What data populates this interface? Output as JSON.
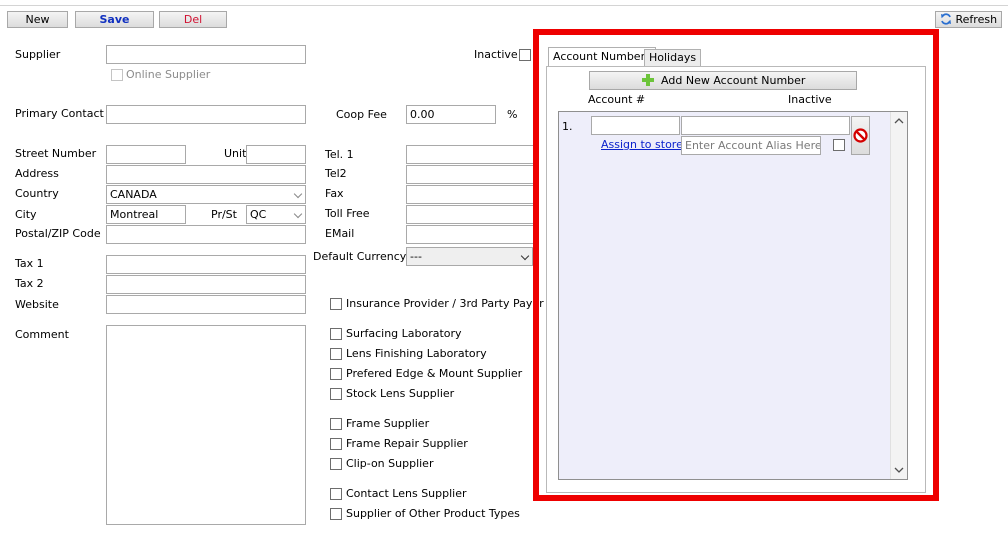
{
  "toolbar": {
    "new_label": "New",
    "save_label": "Save",
    "delete_label": "Del",
    "refresh_label": "Refresh"
  },
  "form": {
    "supplier_label": "Supplier",
    "supplier_value": "",
    "online_supplier_label": "Online Supplier",
    "inactive_label": "Inactive",
    "primary_contact_label": "Primary Contact",
    "primary_contact_value": "",
    "coop_fee_label": "Coop Fee",
    "coop_fee_value": "0.00",
    "coop_fee_unit": "%",
    "street_number_label": "Street Number",
    "street_number_value": "",
    "unit_label": "Unit",
    "unit_value": "",
    "address_label": "Address",
    "address_value": "",
    "country_label": "Country",
    "country_value": "CANADA",
    "city_label": "City",
    "city_value": "Montreal",
    "prst_label": "Pr/St",
    "prst_value": "QC",
    "postal_label": "Postal/ZIP Code",
    "postal_value": "",
    "tel1_label": "Tel. 1",
    "tel2_label": "Tel2",
    "fax_label": "Fax",
    "tollfree_label": "Toll Free",
    "email_label": "EMail",
    "default_currency_label": "Default Currency",
    "default_currency_value": "---",
    "tax1_label": "Tax 1",
    "tax2_label": "Tax 2",
    "website_label": "Website",
    "comment_label": "Comment"
  },
  "checkboxes": [
    {
      "label": "Insurance Provider / 3rd Party Payer",
      "checked": false
    },
    {
      "label": "Surfacing Laboratory",
      "checked": false
    },
    {
      "label": "Lens Finishing Laboratory",
      "checked": false
    },
    {
      "label": "Prefered Edge & Mount Supplier",
      "checked": false
    },
    {
      "label": "Stock Lens Supplier",
      "checked": false
    },
    {
      "label": "Frame Supplier",
      "checked": false
    },
    {
      "label": "Frame Repair Supplier",
      "checked": false
    },
    {
      "label": "Clip-on Supplier",
      "checked": false
    },
    {
      "label": "Contact Lens Supplier",
      "checked": false
    },
    {
      "label": "Supplier of Other Product Types",
      "checked": false
    }
  ],
  "account_panel": {
    "tabs": [
      {
        "label": "Account Numbers",
        "active": true
      },
      {
        "label": "Holidays",
        "active": false
      }
    ],
    "add_button_label": "Add New Account Number",
    "col_account_label": "Account #",
    "col_inactive_label": "Inactive",
    "rows": [
      {
        "index": "1.",
        "account_value": "",
        "second_value": "",
        "assign_link": "Assign to stores",
        "alias_placeholder": "Enter Account Alias Here",
        "inactive": false
      }
    ]
  },
  "colors": {
    "highlight_frame": "#ee0000",
    "save_text": "#1030c0",
    "delete_text": "#d01030",
    "link": "#0b22cc",
    "list_background": "#eeeefa"
  }
}
